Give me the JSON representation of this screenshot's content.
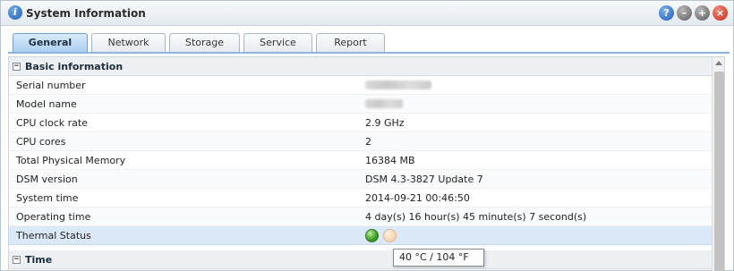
{
  "window": {
    "title": "System Information",
    "title_icon": "info-icon",
    "buttons": [
      {
        "name": "help-button",
        "glyph": "?",
        "icon": "help-icon"
      },
      {
        "name": "minimize-button",
        "glyph": "–",
        "icon": "minimize-icon"
      },
      {
        "name": "maximize-button",
        "glyph": "+",
        "icon": "maximize-icon"
      },
      {
        "name": "close-button",
        "glyph": "×",
        "icon": "close-icon"
      }
    ]
  },
  "tabs": [
    "General",
    "Network",
    "Storage",
    "Service",
    "Report"
  ],
  "active_tab": "General",
  "basic_section": {
    "title": "Basic information",
    "toggle": "−",
    "rows": [
      {
        "label": "Serial number",
        "value": "",
        "redacted": true
      },
      {
        "label": "Model name",
        "value": "",
        "redacted": true
      },
      {
        "label": "CPU clock rate",
        "value": "2.9 GHz"
      },
      {
        "label": "CPU cores",
        "value": "2"
      },
      {
        "label": "Total Physical Memory",
        "value": "16384 MB"
      },
      {
        "label": "DSM version",
        "value": "DSM 4.3-3827 Update 7"
      },
      {
        "label": "System time",
        "value": "2014-09-21 00:46:50"
      },
      {
        "label": "Operating time",
        "value": "4 day(s) 16 hour(s) 45 minute(s) 7 second(s)"
      }
    ],
    "thermal": {
      "label": "Thermal Status",
      "indicator": "green",
      "tooltip": "40 °C / 104 °F"
    }
  },
  "time_section": {
    "title": "Time",
    "toggle": "−"
  },
  "colors": {
    "active_tab": "#a9cdf0",
    "highlight_row": "#dbe8f7",
    "thermal_ok": "#3a9a22",
    "thermal_warm": "#f6c7a0",
    "close_button": "#c92a1a",
    "help_button": "#1f5cb4"
  }
}
